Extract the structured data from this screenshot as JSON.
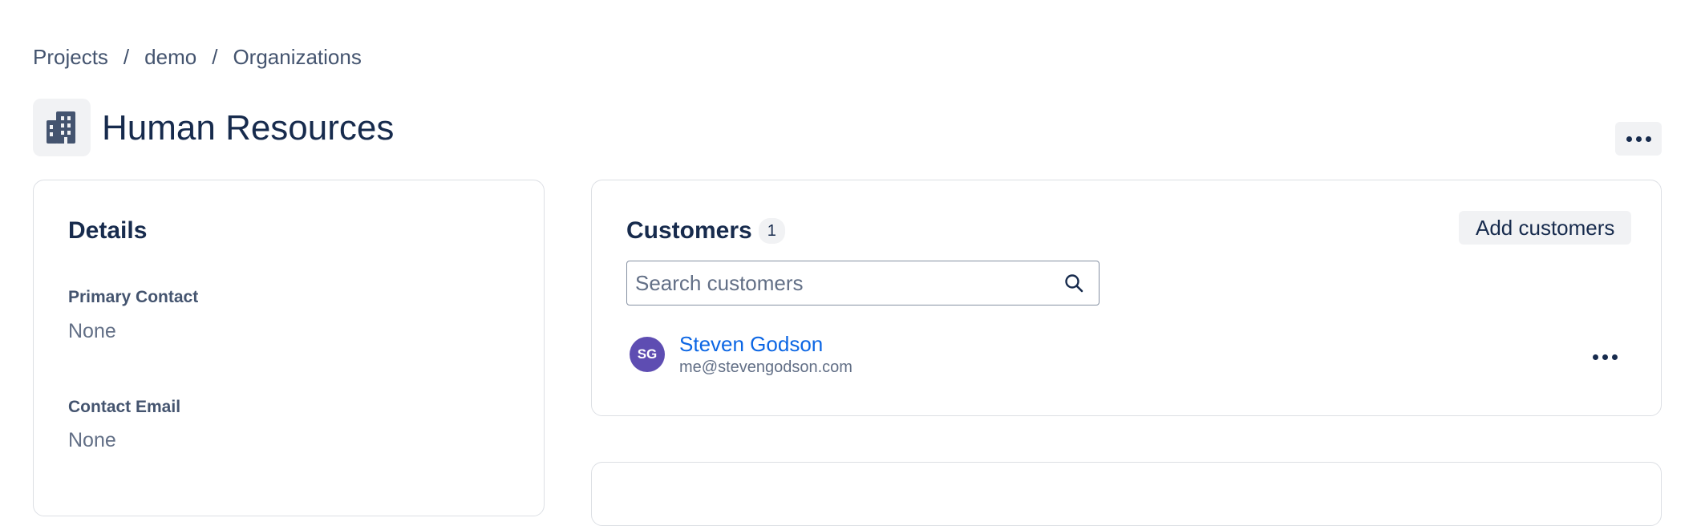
{
  "breadcrumb": {
    "items": [
      "Projects",
      "demo",
      "Organizations"
    ],
    "separator": "/"
  },
  "header": {
    "title": "Human Resources",
    "icon": "building-icon",
    "more_icon": "more-horizontal-icon"
  },
  "details": {
    "heading": "Details",
    "fields": [
      {
        "label": "Primary Contact",
        "value": "None"
      },
      {
        "label": "Contact Email",
        "value": "None"
      }
    ]
  },
  "customers": {
    "heading": "Customers",
    "count": "1",
    "add_label": "Add customers",
    "search_placeholder": "Search customers",
    "list": [
      {
        "initials": "SG",
        "name": "Steven Godson",
        "email": "me@stevengodson.com"
      }
    ]
  },
  "colors": {
    "accent_link": "#0c66e4",
    "avatar_bg": "#5e4db2",
    "text_primary": "#172b4d",
    "text_subtle": "#44546f",
    "neutral_bg": "#f1f2f4"
  }
}
